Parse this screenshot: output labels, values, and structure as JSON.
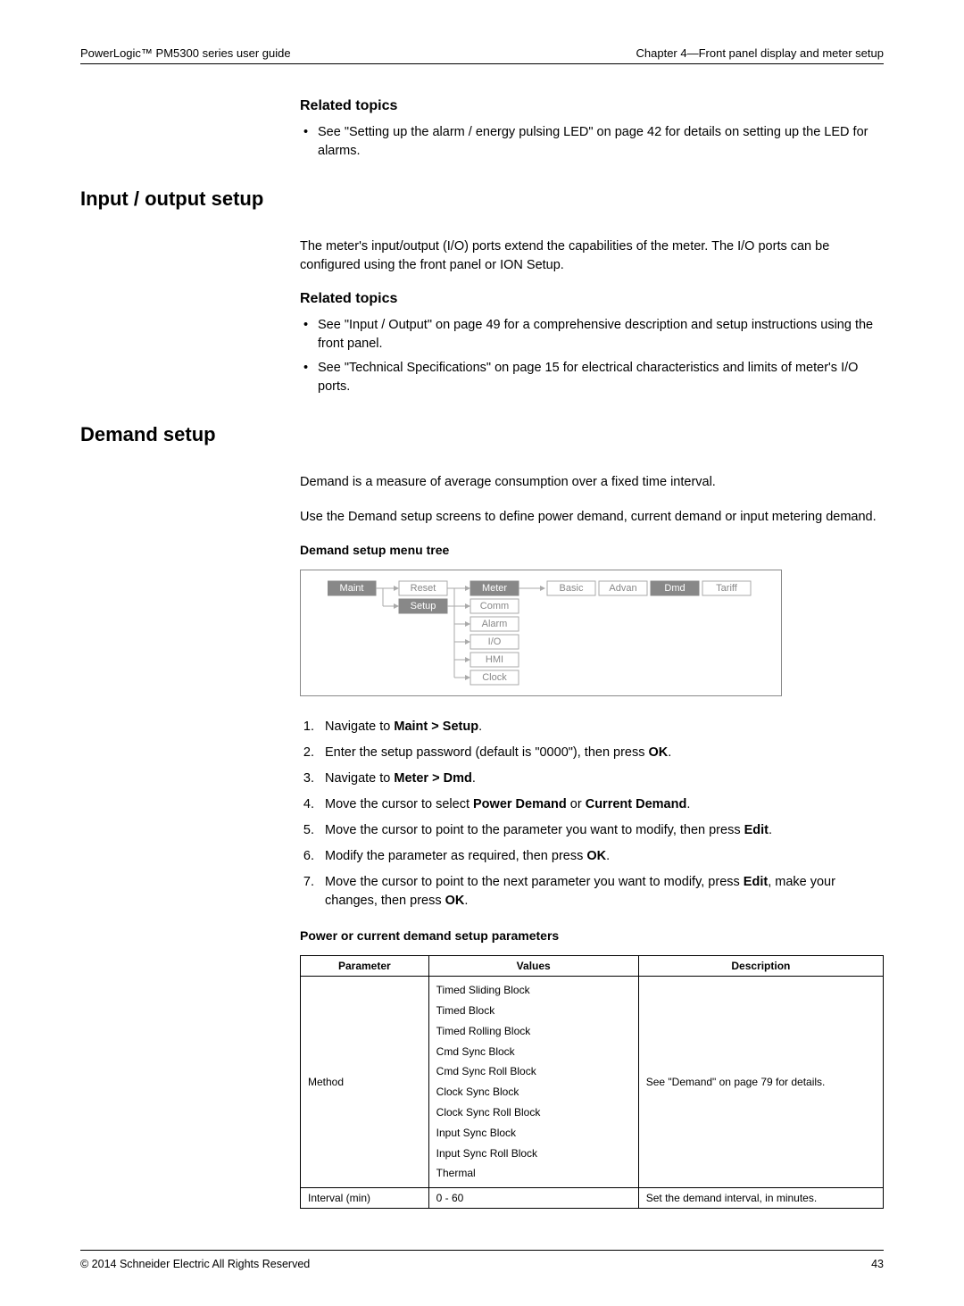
{
  "header": {
    "left": "PowerLogic™ PM5300 series user guide",
    "right": "Chapter 4—Front panel display and meter setup"
  },
  "related1": {
    "title": "Related topics",
    "item1": "See \"Setting up the alarm / energy pulsing LED\" on page 42 for details on setting up the LED for alarms."
  },
  "iosetup": {
    "heading": "Input / output setup",
    "intro": "The meter's input/output (I/O) ports extend the capabilities of the meter. The I/O ports can be configured using the front panel or ION Setup.",
    "related_title": "Related topics",
    "item1": "See \"Input / Output\" on page 49 for a comprehensive description and setup instructions using the front panel.",
    "item2": "See \"Technical Specifications\" on page 15 for electrical characteristics and limits of meter's I/O ports."
  },
  "demand": {
    "heading": "Demand setup",
    "p1": "Demand is a measure of average consumption over a fixed time interval.",
    "p2": "Use the Demand setup screens to define power demand, current demand or input metering demand.",
    "tree_title": "Demand setup menu tree",
    "tree": {
      "col1": {
        "maint": "Maint"
      },
      "col2": {
        "reset": "Reset",
        "setup": "Setup"
      },
      "col3": {
        "meter": "Meter",
        "comm": "Comm",
        "alarm": "Alarm",
        "io": "I/O",
        "hmi": "HMI",
        "clock": "Clock"
      },
      "col4": {
        "basic": "Basic",
        "advan": "Advan",
        "dmd": "Dmd",
        "tariff": "Tariff"
      }
    },
    "steps": {
      "s1a": "Navigate to ",
      "s1b": "Maint > Setup",
      "s1c": ".",
      "s2a": "Enter the setup password (default is \"0000\"), then press ",
      "s2b": "OK",
      "s2c": ".",
      "s3a": "Navigate to ",
      "s3b": "Meter > Dmd",
      "s3c": ".",
      "s4a": "Move the cursor to select ",
      "s4b": "Power Demand",
      "s4c": " or ",
      "s4d": "Current Demand",
      "s4e": ".",
      "s5a": "Move the cursor to point to the parameter you want to modify, then press ",
      "s5b": "Edit",
      "s5c": ".",
      "s6a": "Modify the parameter as required, then press ",
      "s6b": "OK",
      "s6c": ".",
      "s7a": "Move the cursor to point to the next parameter you want to modify, press ",
      "s7b": "Edit",
      "s7c": ", make your changes, then press ",
      "s7d": "OK",
      "s7e": "."
    },
    "table_title": "Power or current demand setup parameters",
    "table": {
      "h1": "Parameter",
      "h2": "Values",
      "h3": "Description",
      "r1_param": "Method",
      "r1_v1": "Timed Sliding Block",
      "r1_v2": "Timed Block",
      "r1_v3": "Timed Rolling Block",
      "r1_v4": "Cmd Sync Block",
      "r1_v5": "Cmd Sync Roll Block",
      "r1_v6": "Clock Sync Block",
      "r1_v7": "Clock Sync Roll Block",
      "r1_v8": "Input Sync Block",
      "r1_v9": "Input Sync Roll Block",
      "r1_v10": "Thermal",
      "r1_desc": "See \"Demand\" on page 79 for details.",
      "r2_param": "Interval (min)",
      "r2_values": "0 - 60",
      "r2_desc": "Set the demand interval, in minutes."
    }
  },
  "footer": {
    "left": "© 2014 Schneider Electric All Rights Reserved",
    "right": "43"
  }
}
